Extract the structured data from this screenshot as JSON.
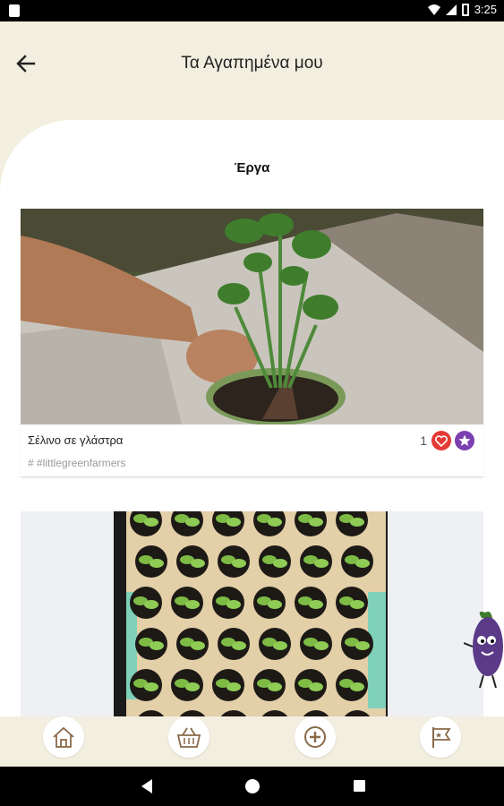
{
  "status_bar": {
    "time": "3:25"
  },
  "header": {
    "title": "Τα Αγαπημένα μου",
    "back_icon": "arrow-left-icon"
  },
  "section": {
    "title": "Έργα"
  },
  "projects": [
    {
      "title": "Σέλινο σε γλάστρα",
      "tag": "# #littlegreenfarmers",
      "likes": "1",
      "image": "hand-planting-celery-in-pot"
    },
    {
      "title": "",
      "tag": "",
      "likes": "",
      "image": "seedlings-in-egg-carton"
    }
  ],
  "bottom_nav": {
    "items": [
      "home-icon",
      "basket-icon",
      "add-circle-icon",
      "flag-icon"
    ]
  },
  "colors": {
    "background": "#f3efe0",
    "heart": "#e53935",
    "star": "#7b3fb0",
    "icon_brown": "#8a6a4a"
  }
}
